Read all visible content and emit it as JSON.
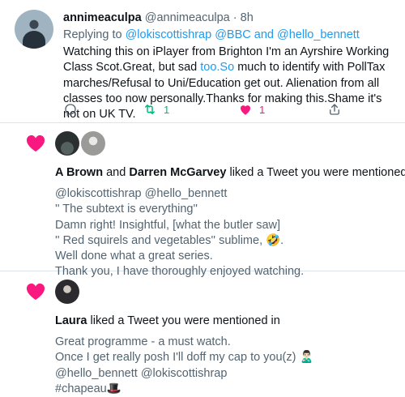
{
  "tweet": {
    "author_name": "annimeaculpa",
    "handle": "@annimeaculpa",
    "separator": "·",
    "time": "8h",
    "replying_prefix": "Replying to",
    "reply_mentions": [
      "@lokiscottishrap",
      "@BBC",
      "@hello_bennett"
    ],
    "reply_and": "and",
    "body_part1": "Watching this on iPlayer from Brighton I'm an Ayrshire Working Class Scot.Great, but sad ",
    "body_link": "too.So",
    "body_part2": " much to identify with PollTax marches/Refusal to Uni/Education get out. Alienation from all classes too now personally.Thanks for making this.Shame it's not on UK TV.",
    "retweet_count": "1",
    "like_count": "1",
    "icons": [
      "reply-icon",
      "retweet-icon",
      "like-icon",
      "share-icon"
    ]
  },
  "notifications": [
    {
      "icon": "heart-icon",
      "user1": "A Brown",
      "joiner": "and",
      "user2": "Darren McGarvey",
      "action": "liked a Tweet you were mentioned in",
      "lines": [
        "@lokiscottishrap @hello_bennett",
        "'' The subtext is everything''",
        "Damn right! Insightful, [what the butler saw]",
        "'' Red squirels and vegetables'' sublime, 🤣.",
        "Well done what a great series.",
        "Thank you, I have thoroughly enjoyed watching."
      ]
    },
    {
      "icon": "heart-icon",
      "user1": "Laura",
      "action": "liked a Tweet you were mentioned in",
      "lines": [
        "Great programme - a must watch.",
        "Once I get really posh I'll doff my cap to you(z) 🙎🏻‍♂️",
        "@hello_bennett @lokiscottishrap",
        "#chapeau🎩"
      ]
    }
  ],
  "colors": {
    "accent": "#1d9bf0",
    "like": "#f91880",
    "retweet": "#00ba7c",
    "muted": "#536471"
  }
}
